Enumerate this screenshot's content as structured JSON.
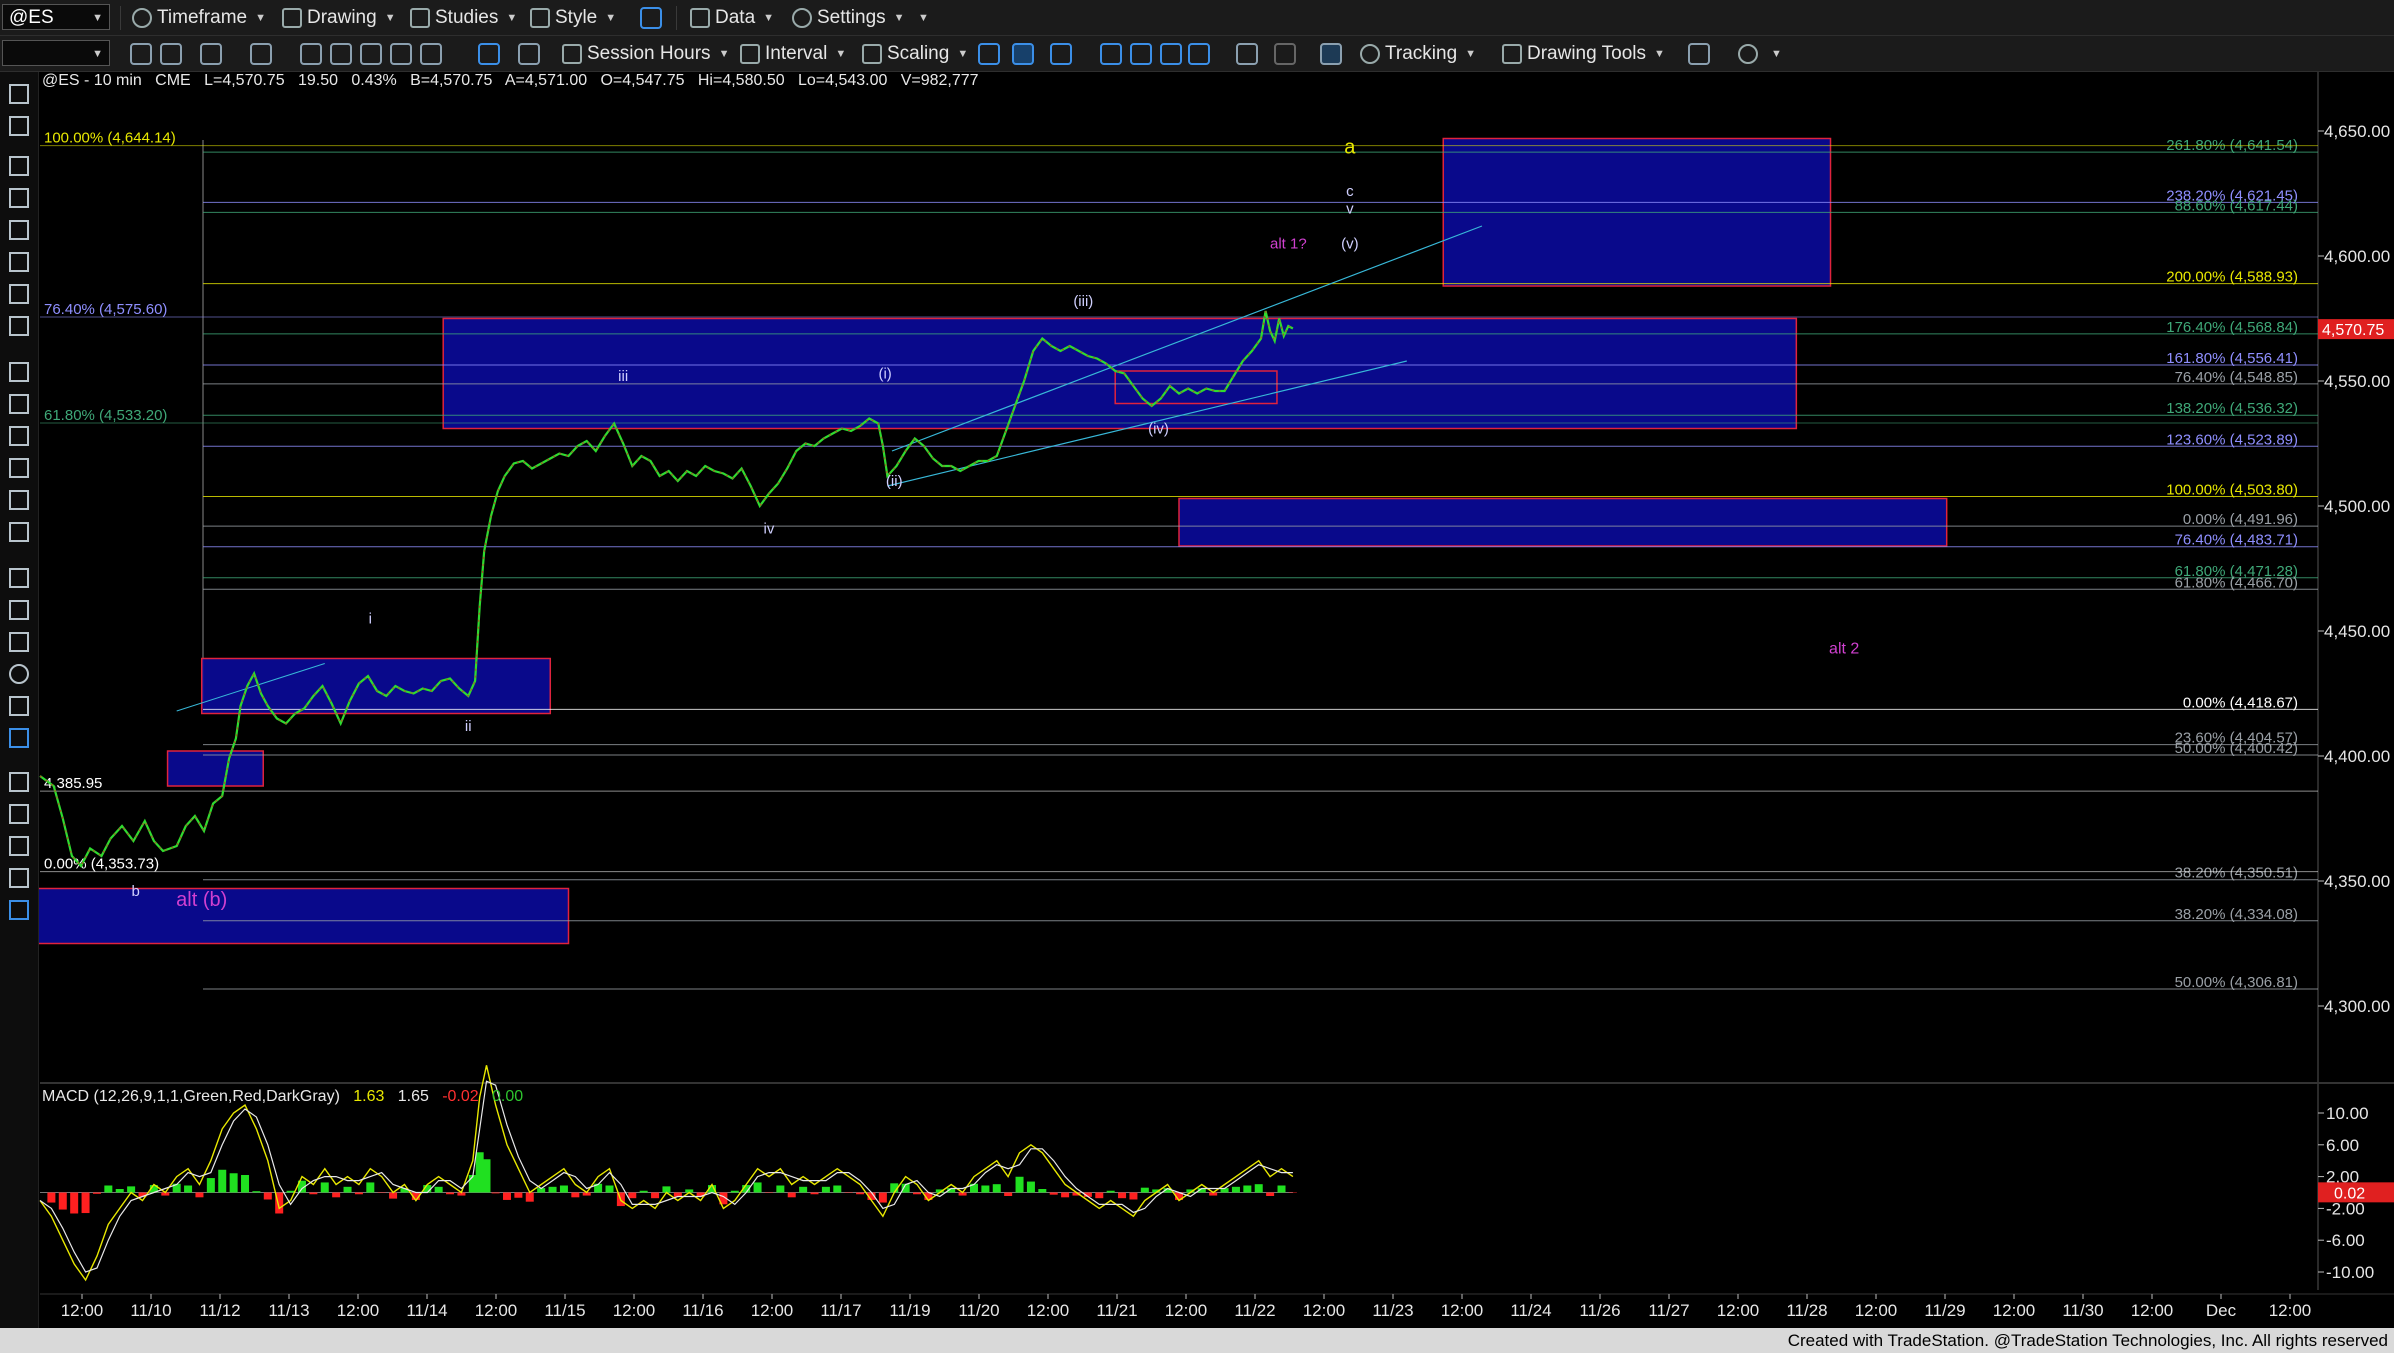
{
  "toolbar1": {
    "symbol": "@ES",
    "items": [
      "Timeframe",
      "Drawing",
      "Studies",
      "Style",
      "Data",
      "Settings"
    ]
  },
  "toolbar2": {
    "items": [
      "Session Hours",
      "Interval",
      "Scaling",
      "Tracking",
      "Drawing Tools"
    ]
  },
  "header": {
    "symbol_interval": "@ES - 10 min",
    "exchange": "CME",
    "last": "L=4,570.75",
    "change": "19.50",
    "change_pct": "0.43%",
    "bid": "B=4,570.75",
    "ask": "A=4,571.00",
    "open": "O=4,547.75",
    "high": "Hi=4,580.50",
    "low": "Lo=4,543.00",
    "volume": "V=982,777"
  },
  "macd_header": {
    "label": "MACD (12,26,9,1,1,Green,Red,DarkGray)",
    "v1": "1.63",
    "v2": "1.65",
    "v3": "-0.02",
    "v4": "0.00"
  },
  "footer": "Created with TradeStation. @TradeStation Technologies, Inc. All rights reserved",
  "chart_data": {
    "type": "line",
    "y_price_ticks": [
      "4,650.00",
      "4,600.00",
      "4,550.00",
      "4,500.00",
      "4,450.00",
      "4,400.00",
      "4,350.00",
      "4,300.00"
    ],
    "y_price_values": [
      4650,
      4600,
      4550,
      4500,
      4450,
      4400,
      4350,
      4300
    ],
    "y_macd_ticks": [
      "10.00",
      "6.00",
      "2.00",
      "-2.00",
      "-6.00",
      "-10.00"
    ],
    "y_macd_values": [
      10,
      6,
      2,
      -2,
      -6,
      -10
    ],
    "last_price_label": "4,570.75",
    "macd_last_label": "0.02",
    "x_tick_labels": [
      "12:00",
      "11/10",
      "11/12",
      "11/13",
      "12:00",
      "11/14",
      "12:00",
      "11/15",
      "12:00",
      "11/16",
      "12:00",
      "11/17",
      "11/19",
      "11/20",
      "12:00",
      "11/21",
      "12:00",
      "11/22",
      "12:00",
      "11/23",
      "12:00",
      "11/24",
      "11/26",
      "11/27",
      "12:00",
      "11/28",
      "12:00",
      "11/29",
      "12:00",
      "11/30",
      "12:00",
      "Dec",
      "12:00"
    ],
    "fib_right_labels": [
      {
        "text": "261.80% (4,641.54)",
        "price": 4641.54,
        "color": "#3fa878"
      },
      {
        "text": "238.20% (4,621.45)",
        "price": 4621.45,
        "color": "#8f8fff"
      },
      {
        "text": "88.60% (4,617.44)",
        "price": 4617.44,
        "color": "#3fa878"
      },
      {
        "text": "200.00% (4,588.93)",
        "price": 4588.93,
        "color": "#e8e800"
      },
      {
        "text": "176.40% (4,568.84)",
        "price": 4568.84,
        "color": "#3fa878"
      },
      {
        "text": "161.80% (4,556.41)",
        "price": 4556.41,
        "color": "#8f8fff"
      },
      {
        "text": "76.40% (4,548.85)",
        "price": 4548.85,
        "color": "#9aa0a6"
      },
      {
        "text": "138.20% (4,536.32)",
        "price": 4536.32,
        "color": "#3fa878"
      },
      {
        "text": "123.60% (4,523.89)",
        "price": 4523.89,
        "color": "#8f8fff"
      },
      {
        "text": "100.00% (4,503.80)",
        "price": 4503.8,
        "color": "#e8e800"
      },
      {
        "text": "0.00% (4,491.96)",
        "price": 4491.96,
        "color": "#9aa0a6"
      },
      {
        "text": "76.40% (4,483.71)",
        "price": 4483.71,
        "color": "#8f8fff"
      },
      {
        "text": "61.80% (4,471.28)",
        "price": 4471.28,
        "color": "#3fa878"
      },
      {
        "text": "61.80% (4,466.70)",
        "price": 4466.7,
        "color": "#9aa0a6"
      },
      {
        "text": "0.00% (4,418.67)",
        "price": 4418.67,
        "color": "#ffffff"
      },
      {
        "text": "23.60% (4,404.57)",
        "price": 4404.57,
        "color": "#9aa0a6"
      },
      {
        "text": "50.00% (4,400.42)",
        "price": 4400.42,
        "color": "#9aa0a6"
      },
      {
        "text": "38.20% (4,350.51)",
        "price": 4350.51,
        "color": "#9aa0a6"
      },
      {
        "text": "38.20% (4,334.08)",
        "price": 4334.08,
        "color": "#9aa0a6"
      },
      {
        "text": "50.00% (4,306.81)",
        "price": 4306.81,
        "color": "#9aa0a6"
      }
    ],
    "fib_left_labels": [
      {
        "text": "100.00% (4,644.14)",
        "price": 4644.14,
        "color": "#e8e800"
      },
      {
        "text": "76.40% (4,575.60)",
        "price": 4575.6,
        "color": "#8f8fff"
      },
      {
        "text": "61.80% (4,533.20)",
        "price": 4533.2,
        "color": "#3fa878"
      },
      {
        "text": "4,385.95",
        "price": 4385.95,
        "color": "#ffffff"
      },
      {
        "text": "0.00% (4,353.73)",
        "price": 4353.73,
        "color": "#ffffff"
      }
    ],
    "wave_labels": [
      {
        "text": "a",
        "color": "#e8e800",
        "price": 4641,
        "slot": 0.575,
        "size": 20
      },
      {
        "text": "c",
        "color": "#d0d0ff",
        "price": 4624,
        "slot": 0.575,
        "size": 15
      },
      {
        "text": "v",
        "color": "#d0d0ff",
        "price": 4617,
        "slot": 0.575,
        "size": 15
      },
      {
        "text": "(v)",
        "color": "#d0d0ff",
        "price": 4603,
        "slot": 0.575,
        "size": 15
      },
      {
        "text": "alt 1?",
        "color": "#d040d0",
        "price": 4603,
        "slot": 0.548,
        "size": 15
      },
      {
        "text": "(iii)",
        "color": "#d0d0ff",
        "price": 4580,
        "slot": 0.458,
        "size": 15
      },
      {
        "text": "iii",
        "color": "#d0d0ff",
        "price": 4550,
        "slot": 0.256,
        "size": 15
      },
      {
        "text": "(i)",
        "color": "#d0d0ff",
        "price": 4551,
        "slot": 0.371,
        "size": 15
      },
      {
        "text": "(iv)",
        "color": "#d0d0ff",
        "price": 4529,
        "slot": 0.491,
        "size": 15
      },
      {
        "text": "(ii)",
        "color": "#d0d0ff",
        "price": 4508,
        "slot": 0.375,
        "size": 15
      },
      {
        "text": "iv",
        "color": "#d0d0ff",
        "price": 4489,
        "slot": 0.32,
        "size": 15
      },
      {
        "text": "i",
        "color": "#d0d0ff",
        "price": 4453,
        "slot": 0.145,
        "size": 15
      },
      {
        "text": "ii",
        "color": "#d0d0ff",
        "price": 4410,
        "slot": 0.188,
        "size": 15
      },
      {
        "text": "alt 2",
        "color": "#d040d0",
        "price": 4441,
        "slot": 0.792,
        "size": 16
      },
      {
        "text": "b",
        "color": "#d0d0ff",
        "price": 4344,
        "slot": 0.042,
        "size": 15
      },
      {
        "text": "alt (b)",
        "color": "#d040d0",
        "price": 4340,
        "slot": 0.071,
        "size": 20
      }
    ],
    "price_series": [
      [
        0.0,
        4392
      ],
      [
        0.006,
        4388
      ],
      [
        0.01,
        4375
      ],
      [
        0.014,
        4360
      ],
      [
        0.018,
        4356
      ],
      [
        0.022,
        4363
      ],
      [
        0.027,
        4360
      ],
      [
        0.031,
        4367
      ],
      [
        0.036,
        4372
      ],
      [
        0.041,
        4366
      ],
      [
        0.046,
        4374
      ],
      [
        0.05,
        4366
      ],
      [
        0.054,
        4362
      ],
      [
        0.06,
        4364
      ],
      [
        0.064,
        4372
      ],
      [
        0.068,
        4376
      ],
      [
        0.072,
        4370
      ],
      [
        0.076,
        4381
      ],
      [
        0.08,
        4384
      ],
      [
        0.083,
        4399
      ],
      [
        0.086,
        4407
      ],
      [
        0.088,
        4420
      ],
      [
        0.091,
        4428
      ],
      [
        0.094,
        4433
      ],
      [
        0.097,
        4425
      ],
      [
        0.1,
        4420
      ],
      [
        0.104,
        4415
      ],
      [
        0.108,
        4413
      ],
      [
        0.112,
        4417
      ],
      [
        0.116,
        4419
      ],
      [
        0.12,
        4424
      ],
      [
        0.124,
        4428
      ],
      [
        0.128,
        4421
      ],
      [
        0.132,
        4413
      ],
      [
        0.136,
        4422
      ],
      [
        0.14,
        4429
      ],
      [
        0.144,
        4432
      ],
      [
        0.148,
        4426
      ],
      [
        0.152,
        4424
      ],
      [
        0.156,
        4428
      ],
      [
        0.16,
        4426
      ],
      [
        0.164,
        4425
      ],
      [
        0.168,
        4427
      ],
      [
        0.172,
        4426
      ],
      [
        0.176,
        4430
      ],
      [
        0.18,
        4431
      ],
      [
        0.184,
        4427
      ],
      [
        0.188,
        4424
      ],
      [
        0.191,
        4430
      ],
      [
        0.193,
        4460
      ],
      [
        0.195,
        4482
      ],
      [
        0.198,
        4496
      ],
      [
        0.201,
        4506
      ],
      [
        0.204,
        4512
      ],
      [
        0.208,
        4517
      ],
      [
        0.212,
        4518
      ],
      [
        0.216,
        4515
      ],
      [
        0.22,
        4517
      ],
      [
        0.224,
        4519
      ],
      [
        0.228,
        4521
      ],
      [
        0.232,
        4520
      ],
      [
        0.236,
        4524
      ],
      [
        0.24,
        4526
      ],
      [
        0.244,
        4522
      ],
      [
        0.248,
        4528
      ],
      [
        0.252,
        4533
      ],
      [
        0.256,
        4525
      ],
      [
        0.26,
        4516
      ],
      [
        0.264,
        4520
      ],
      [
        0.268,
        4518
      ],
      [
        0.272,
        4512
      ],
      [
        0.276,
        4514
      ],
      [
        0.28,
        4510
      ],
      [
        0.284,
        4514
      ],
      [
        0.288,
        4512
      ],
      [
        0.292,
        4516
      ],
      [
        0.296,
        4514
      ],
      [
        0.3,
        4513
      ],
      [
        0.304,
        4511
      ],
      [
        0.308,
        4515
      ],
      [
        0.312,
        4508
      ],
      [
        0.316,
        4500
      ],
      [
        0.32,
        4505
      ],
      [
        0.324,
        4509
      ],
      [
        0.328,
        4515
      ],
      [
        0.332,
        4522
      ],
      [
        0.336,
        4525
      ],
      [
        0.34,
        4524
      ],
      [
        0.344,
        4527
      ],
      [
        0.348,
        4529
      ],
      [
        0.352,
        4531
      ],
      [
        0.356,
        4530
      ],
      [
        0.36,
        4532
      ],
      [
        0.364,
        4535
      ],
      [
        0.368,
        4533
      ],
      [
        0.37,
        4524
      ],
      [
        0.372,
        4512
      ],
      [
        0.376,
        4516
      ],
      [
        0.38,
        4522
      ],
      [
        0.384,
        4527
      ],
      [
        0.388,
        4524
      ],
      [
        0.392,
        4519
      ],
      [
        0.396,
        4516
      ],
      [
        0.4,
        4516
      ],
      [
        0.404,
        4514
      ],
      [
        0.408,
        4516
      ],
      [
        0.412,
        4518
      ],
      [
        0.416,
        4518
      ],
      [
        0.42,
        4520
      ],
      [
        0.424,
        4530
      ],
      [
        0.428,
        4540
      ],
      [
        0.432,
        4550
      ],
      [
        0.436,
        4562
      ],
      [
        0.44,
        4567
      ],
      [
        0.444,
        4564
      ],
      [
        0.448,
        4562
      ],
      [
        0.452,
        4564
      ],
      [
        0.456,
        4562
      ],
      [
        0.46,
        4560
      ],
      [
        0.464,
        4559
      ],
      [
        0.468,
        4557
      ],
      [
        0.472,
        4554
      ],
      [
        0.476,
        4553
      ],
      [
        0.48,
        4548
      ],
      [
        0.484,
        4543
      ],
      [
        0.488,
        4540
      ],
      [
        0.492,
        4543
      ],
      [
        0.496,
        4548
      ],
      [
        0.5,
        4545
      ],
      [
        0.504,
        4547
      ],
      [
        0.508,
        4545
      ],
      [
        0.512,
        4547
      ],
      [
        0.516,
        4546
      ],
      [
        0.52,
        4546
      ],
      [
        0.524,
        4552
      ],
      [
        0.528,
        4558
      ],
      [
        0.532,
        4562
      ],
      [
        0.536,
        4567
      ],
      [
        0.538,
        4578
      ],
      [
        0.54,
        4570
      ],
      [
        0.542,
        4566
      ],
      [
        0.544,
        4575
      ],
      [
        0.546,
        4568
      ],
      [
        0.548,
        4572
      ],
      [
        0.55,
        4571
      ]
    ],
    "macd_series": [
      [
        0.0,
        -1
      ],
      [
        0.005,
        -3
      ],
      [
        0.01,
        -6
      ],
      [
        0.015,
        -9
      ],
      [
        0.02,
        -11
      ],
      [
        0.025,
        -8
      ],
      [
        0.03,
        -4
      ],
      [
        0.035,
        -2
      ],
      [
        0.04,
        0
      ],
      [
        0.045,
        -1
      ],
      [
        0.05,
        1
      ],
      [
        0.055,
        0
      ],
      [
        0.06,
        2
      ],
      [
        0.065,
        3
      ],
      [
        0.07,
        1
      ],
      [
        0.075,
        4
      ],
      [
        0.08,
        8
      ],
      [
        0.085,
        10
      ],
      [
        0.09,
        11
      ],
      [
        0.095,
        8
      ],
      [
        0.1,
        4
      ],
      [
        0.105,
        -2
      ],
      [
        0.11,
        -1
      ],
      [
        0.115,
        2
      ],
      [
        0.12,
        1
      ],
      [
        0.125,
        3
      ],
      [
        0.13,
        1
      ],
      [
        0.135,
        2
      ],
      [
        0.14,
        1
      ],
      [
        0.145,
        3
      ],
      [
        0.15,
        2
      ],
      [
        0.155,
        0
      ],
      [
        0.16,
        1
      ],
      [
        0.165,
        -1
      ],
      [
        0.17,
        1
      ],
      [
        0.175,
        2
      ],
      [
        0.18,
        1
      ],
      [
        0.185,
        0
      ],
      [
        0.19,
        4
      ],
      [
        0.193,
        12
      ],
      [
        0.196,
        16
      ],
      [
        0.2,
        11
      ],
      [
        0.205,
        6
      ],
      [
        0.21,
        3
      ],
      [
        0.215,
        0
      ],
      [
        0.22,
        1
      ],
      [
        0.225,
        2
      ],
      [
        0.23,
        3
      ],
      [
        0.235,
        1
      ],
      [
        0.24,
        0
      ],
      [
        0.245,
        2
      ],
      [
        0.25,
        3
      ],
      [
        0.255,
        -1
      ],
      [
        0.26,
        -2
      ],
      [
        0.265,
        -1
      ],
      [
        0.27,
        -2
      ],
      [
        0.275,
        0
      ],
      [
        0.28,
        -1
      ],
      [
        0.285,
        0
      ],
      [
        0.29,
        -1
      ],
      [
        0.295,
        1
      ],
      [
        0.3,
        -2
      ],
      [
        0.305,
        -1
      ],
      [
        0.31,
        1
      ],
      [
        0.315,
        3
      ],
      [
        0.32,
        2
      ],
      [
        0.325,
        3
      ],
      [
        0.33,
        1
      ],
      [
        0.335,
        2
      ],
      [
        0.34,
        1
      ],
      [
        0.345,
        2
      ],
      [
        0.35,
        3
      ],
      [
        0.355,
        2
      ],
      [
        0.36,
        1
      ],
      [
        0.365,
        -1
      ],
      [
        0.37,
        -3
      ],
      [
        0.375,
        0
      ],
      [
        0.38,
        2
      ],
      [
        0.385,
        1
      ],
      [
        0.39,
        -1
      ],
      [
        0.395,
        0
      ],
      [
        0.4,
        1
      ],
      [
        0.405,
        0
      ],
      [
        0.41,
        2
      ],
      [
        0.415,
        3
      ],
      [
        0.42,
        4
      ],
      [
        0.425,
        2
      ],
      [
        0.43,
        5
      ],
      [
        0.435,
        6
      ],
      [
        0.44,
        5
      ],
      [
        0.445,
        3
      ],
      [
        0.45,
        1
      ],
      [
        0.455,
        0
      ],
      [
        0.46,
        -1
      ],
      [
        0.465,
        -2
      ],
      [
        0.47,
        -1
      ],
      [
        0.475,
        -2
      ],
      [
        0.48,
        -3
      ],
      [
        0.485,
        -1
      ],
      [
        0.49,
        0
      ],
      [
        0.495,
        1
      ],
      [
        0.5,
        -1
      ],
      [
        0.505,
        0
      ],
      [
        0.51,
        1
      ],
      [
        0.515,
        0
      ],
      [
        0.52,
        1
      ],
      [
        0.525,
        2
      ],
      [
        0.53,
        3
      ],
      [
        0.535,
        4
      ],
      [
        0.54,
        2
      ],
      [
        0.545,
        3
      ],
      [
        0.55,
        2
      ]
    ]
  }
}
